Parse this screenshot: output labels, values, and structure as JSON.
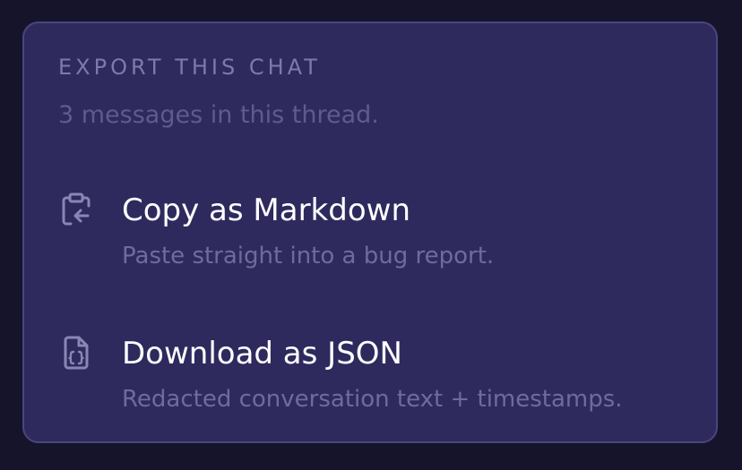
{
  "panel": {
    "title": "EXPORT THIS CHAT",
    "subtitle": "3 messages in this thread."
  },
  "options": [
    {
      "icon": "clipboard-arrow-left-icon",
      "label": "Copy as Markdown",
      "description": "Paste straight into a bug report."
    },
    {
      "icon": "file-json-icon",
      "label": "Download as JSON",
      "description": "Redacted conversation text + timestamps."
    }
  ],
  "colors": {
    "background": "#16142a",
    "panel": "#2e2a5e",
    "panel_border": "#4a4580",
    "label": "#ffffff",
    "muted": "#6f6b9a",
    "icon": "#8a86b4"
  }
}
